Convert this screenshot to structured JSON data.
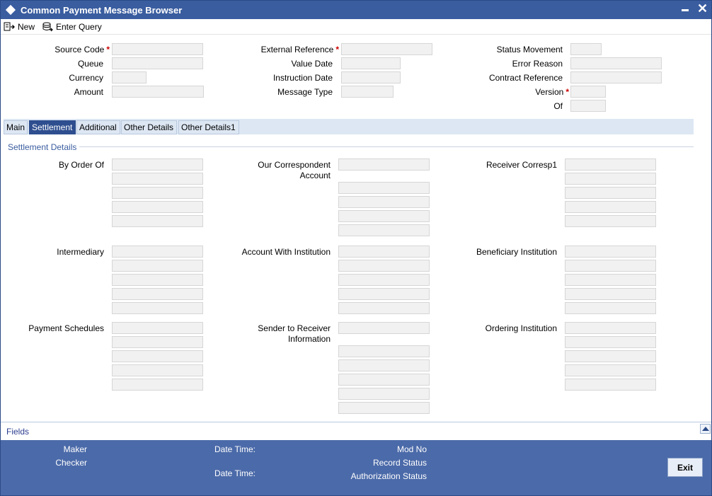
{
  "window": {
    "title": "Common Payment Message Browser"
  },
  "toolbar": {
    "new_label": "New",
    "enter_query_label": "Enter Query"
  },
  "header": {
    "source_code": "Source Code",
    "queue": "Queue",
    "currency": "Currency",
    "amount": "Amount",
    "external_reference": "External Reference",
    "value_date": "Value Date",
    "instruction_date": "Instruction Date",
    "message_type": "Message Type",
    "status_movement": "Status Movement",
    "error_reason": "Error Reason",
    "contract_reference": "Contract Reference",
    "version": "Version",
    "of": "Of",
    "required_mark": "*"
  },
  "tabs": [
    {
      "label": "Main"
    },
    {
      "label": "Settlement"
    },
    {
      "label": "Additional"
    },
    {
      "label": "Other Details"
    },
    {
      "label": "Other Details1"
    }
  ],
  "settlement": {
    "section_title": "Settlement Details",
    "by_order_of": "By Order Of",
    "our_correspondent_line1": "Our Correspondent",
    "our_correspondent_line2": "Account",
    "receiver_corresp1": "Receiver Corresp1",
    "intermediary": "Intermediary",
    "account_with_institution": "Account With Institution",
    "beneficiary_institution": "Beneficiary Institution",
    "payment_schedules": "Payment Schedules",
    "sender_to_receiver_line1": "Sender to Receiver",
    "sender_to_receiver_line2": "Information",
    "ordering_institution": "Ordering Institution"
  },
  "fields_bar": {
    "label": "Fields"
  },
  "footer": {
    "maker": "Maker",
    "checker": "Checker",
    "date_time_1": "Date Time:",
    "date_time_2": "Date Time:",
    "mod_no": "Mod No",
    "record_status": "Record Status",
    "authorization_status": "Authorization Status",
    "exit_label": "Exit"
  },
  "colors": {
    "titlebar": "#3a5da0",
    "active_tab": "#2e4e8f",
    "footer": "#4b6aa9",
    "required": "#cc0000"
  }
}
